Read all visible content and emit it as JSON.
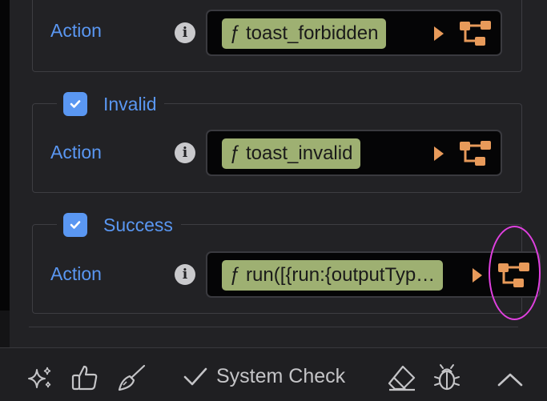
{
  "sections": [
    {
      "row_label": "Action",
      "action_value": "ƒ toast_forbidden"
    },
    {
      "title": "Invalid",
      "checked": true,
      "row_label": "Action",
      "action_value": "ƒ toast_invalid"
    },
    {
      "title": "Success",
      "checked": true,
      "row_label": "Action",
      "action_value": "ƒ run([{run:{outputTyp…"
    }
  ],
  "info_glyph": "i",
  "bottom_bar": {
    "system_check_label": "System Check"
  },
  "colors": {
    "accent": "#5a97f2",
    "pill": "#9eb072",
    "flow_icon": "#e89a5a",
    "highlight": "#e040e0"
  },
  "icons": [
    "sparkles-icon",
    "thumbs-up-icon",
    "brush-icon",
    "checkmark-icon",
    "eraser-icon",
    "bug-icon",
    "chevron-up-icon",
    "info-icon",
    "play-icon",
    "flow-icon"
  ]
}
